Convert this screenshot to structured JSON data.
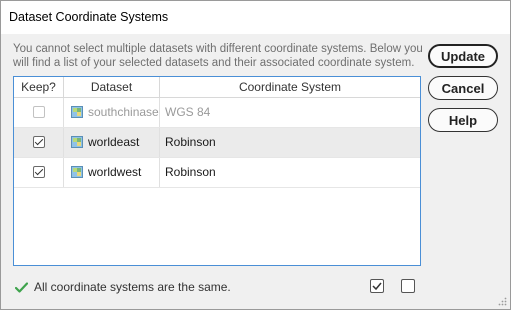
{
  "dialog": {
    "title": "Dataset Coordinate Systems",
    "description": "You cannot select multiple datasets with different coordinate systems. Below you will find a list of your selected datasets and their associated coordinate system."
  },
  "buttons": {
    "update": "Update",
    "cancel": "Cancel",
    "help": "Help"
  },
  "table": {
    "headers": {
      "keep": "Keep?",
      "dataset": "Dataset",
      "coordinate_system": "Coordinate System"
    },
    "rows": [
      {
        "keep": false,
        "keep_enabled": false,
        "dataset": "southchinasea",
        "coordinate_system": "WGS 84",
        "dimmed": true
      },
      {
        "keep": true,
        "keep_enabled": true,
        "dataset": "worldeast",
        "coordinate_system": "Robinson",
        "selected": true
      },
      {
        "keep": true,
        "keep_enabled": true,
        "dataset": "worldwest",
        "coordinate_system": "Robinson"
      }
    ]
  },
  "status": {
    "icon": "checkmark-icon",
    "color": "#3fa34d",
    "message": "All coordinate systems are the same."
  },
  "footer_icons": [
    "check-all-icon",
    "uncheck-all-icon"
  ]
}
